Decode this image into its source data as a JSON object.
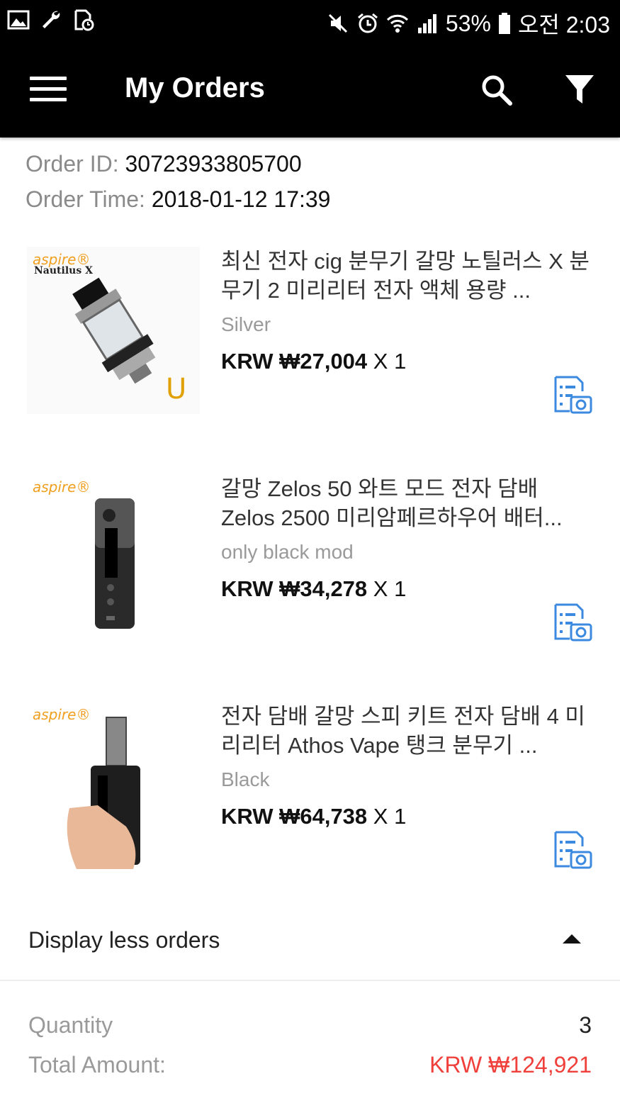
{
  "status_bar": {
    "battery": "53%",
    "time": "오전 2:03"
  },
  "app_bar": {
    "title": "My Orders"
  },
  "order": {
    "id_label": "Order ID:",
    "id_value": "30723933805700",
    "time_label": "Order Time:",
    "time_value": "2018-01-12 17:39"
  },
  "items": [
    {
      "brand": "aspire®",
      "brand_sub": "Nautilus X",
      "title": "최신 전자 cig 분무기 갈망 노틸러스 X 분무기 2 미리리터 전자 액체 용량 ...",
      "variant": "Silver",
      "price": "KRW ₩27,004",
      "qty": " X 1"
    },
    {
      "brand": "aspire®",
      "brand_sub": "",
      "title": "갈망 Zelos 50 와트 모드 전자 담배 Zelos 2500 미리암페르하우어 배터...",
      "variant": "only black mod",
      "price": "KRW ₩34,278",
      "qty": " X 1"
    },
    {
      "brand": "aspire®",
      "brand_sub": "",
      "title": "전자 담배 갈망 스피 키트 전자 담배 4 미리리터 Athos Vape 탱크 분무기 ...",
      "variant": "Black",
      "price": "KRW ₩64,738",
      "qty": " X 1"
    }
  ],
  "display_less_label": "Display less orders",
  "summary": {
    "quantity_label": "Quantity",
    "quantity_value": "3",
    "total_label": "Total Amount:",
    "total_value": "KRW ₩124,921"
  },
  "colors": {
    "accent_red": "#f0403c",
    "icon_blue": "#3b8ae0"
  },
  "icons": [
    "gallery-icon",
    "wrench-icon",
    "clock-file-icon",
    "mute-icon",
    "alarm-icon",
    "wifi-icon",
    "signal-icon",
    "battery-icon",
    "menu-icon",
    "search-icon",
    "filter-icon",
    "review-photo-icon",
    "caret-up-icon"
  ]
}
